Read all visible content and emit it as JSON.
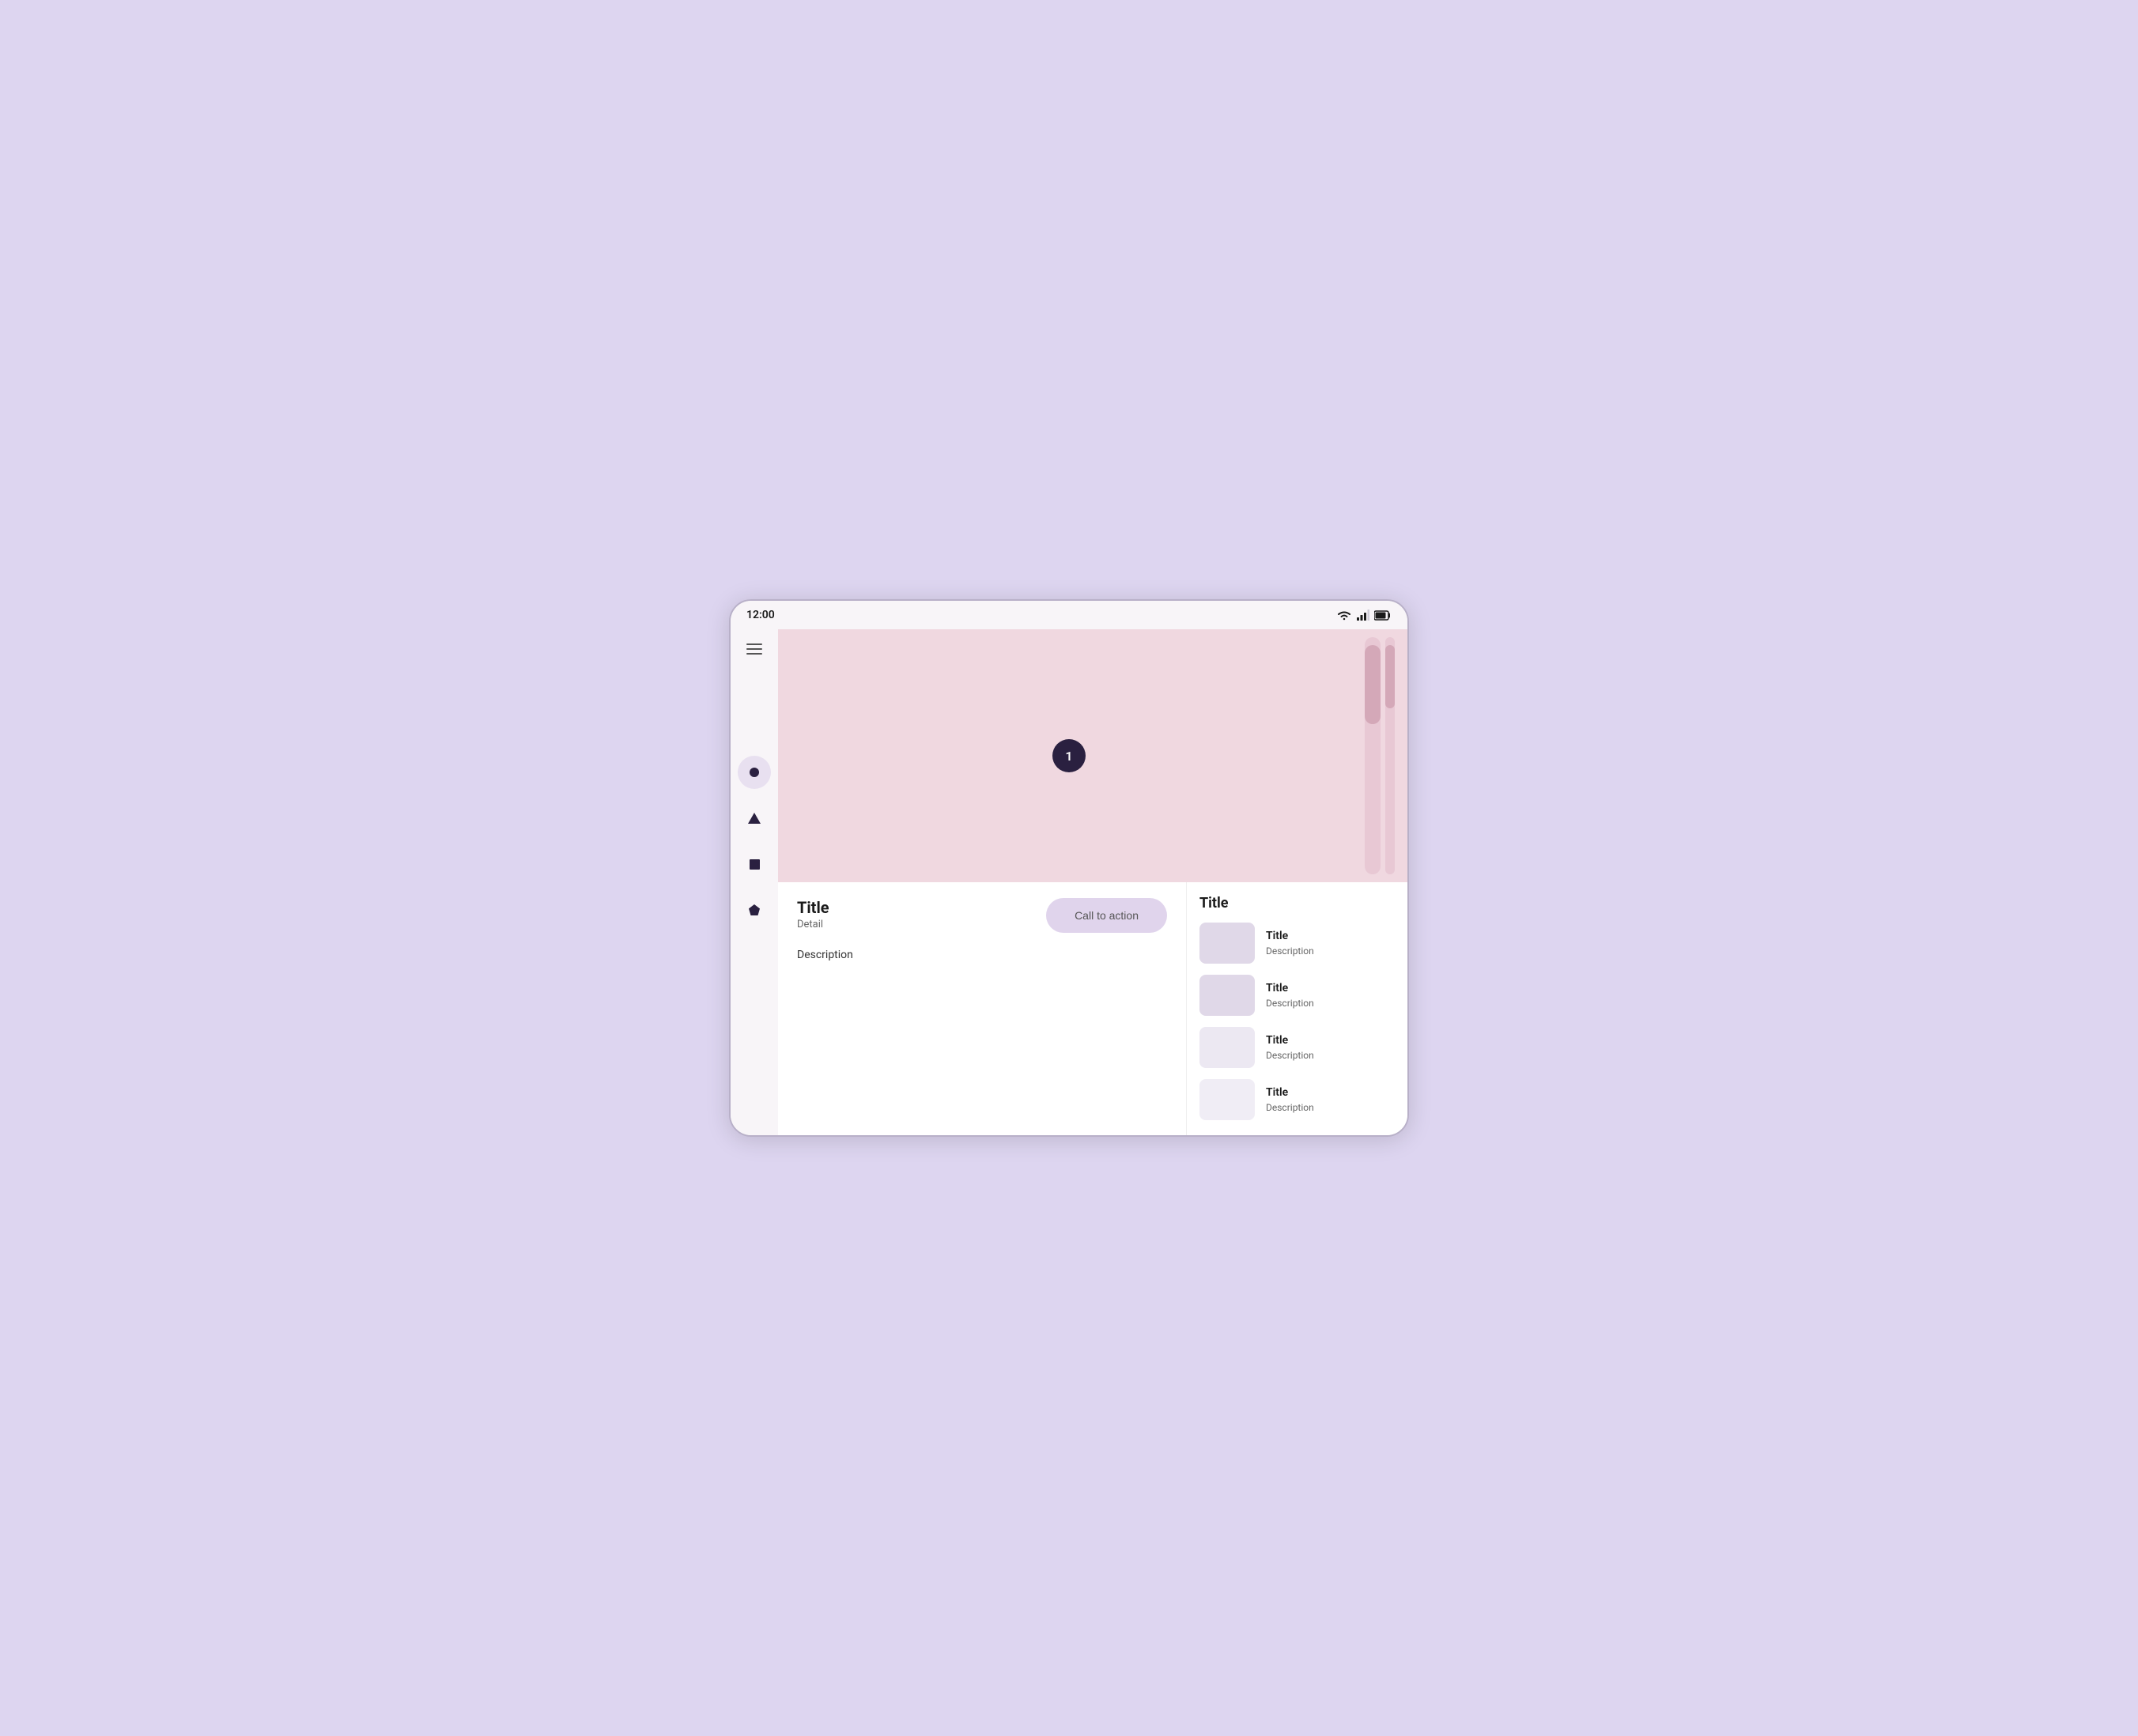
{
  "device": {
    "status_bar": {
      "time": "12:00"
    }
  },
  "sidebar": {
    "menu_label": "Menu",
    "nav_items": [
      {
        "id": "circle",
        "label": "Circle nav",
        "active": true
      },
      {
        "id": "triangle",
        "label": "Triangle nav",
        "active": false
      },
      {
        "id": "square",
        "label": "Square nav",
        "active": false
      },
      {
        "id": "pentagon",
        "label": "Pentagon nav",
        "active": false
      }
    ]
  },
  "hero": {
    "badge_number": "1"
  },
  "content": {
    "title": "Title",
    "detail": "Detail",
    "cta_label": "Call to action",
    "description": "Description"
  },
  "right_sidebar": {
    "title": "Title",
    "items": [
      {
        "title": "Title",
        "description": "Description"
      },
      {
        "title": "Title",
        "description": "Description"
      },
      {
        "title": "Title",
        "description": "Description"
      },
      {
        "title": "Title",
        "description": "Description"
      }
    ]
  }
}
